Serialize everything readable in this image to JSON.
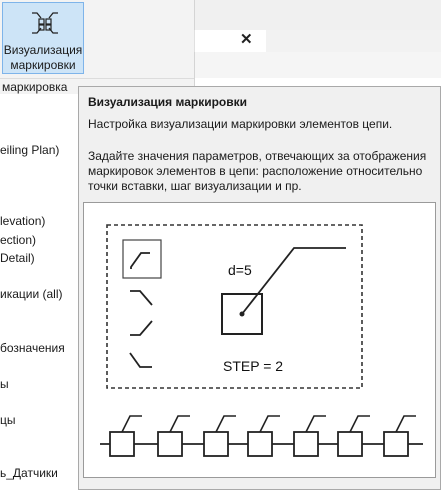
{
  "ribbon": {
    "button_label": "Визуализация маркировки",
    "button_icon": "marking-visualization-icon",
    "panel_label": "маркировка"
  },
  "tab": {
    "close_glyph": "✕"
  },
  "browser": {
    "items": [
      "eiling Plan)",
      "levation)",
      "ection)",
      "Detail)",
      "икации (all)",
      "бозначения",
      "ы",
      "цы",
      "ь_Датчики"
    ]
  },
  "tooltip": {
    "title": "Визуализация маркировки",
    "description": "Настройка визуализации маркировки элементов цепи.",
    "details": "Задайте значения параметров, отвечающих за отображения маркировок элементов в цепи: расположение относительно точки вставки, шаг визуализации и пр.",
    "diagram": {
      "d_label": "d=5",
      "step_label": "STEP = 2"
    }
  }
}
